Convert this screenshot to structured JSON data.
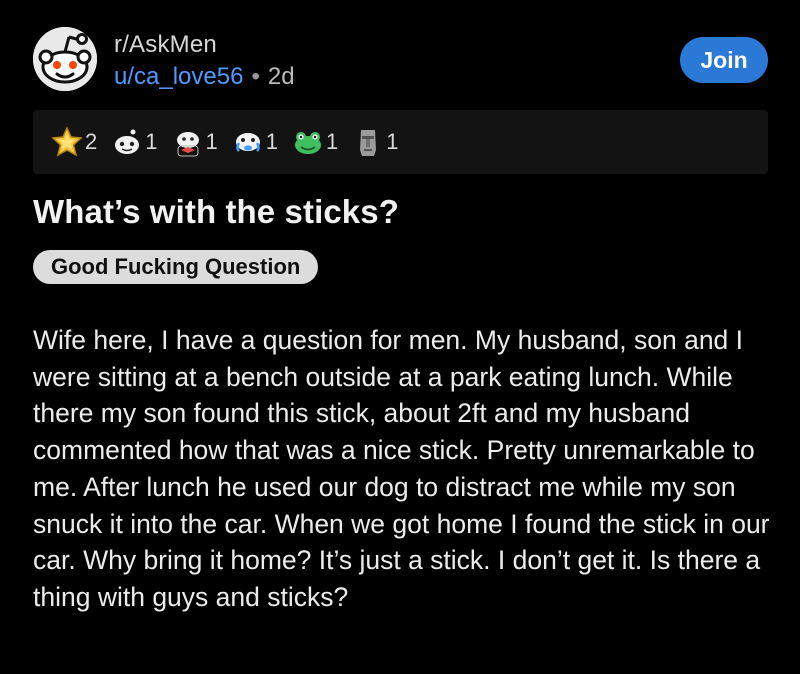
{
  "post": {
    "subreddit": "r/AskMen",
    "username": "u/ca_love56",
    "separator": "•",
    "age": "2d",
    "join_label": "Join",
    "title": "What’s with the sticks?",
    "flair": "Good Fucking Question",
    "body": "Wife here, I have a question for men. My husband, son and I were sitting at a bench outside at a park eating lunch. While there my son found this stick, about 2ft and my husband commented how that was a nice stick. Pretty unremarkable to me. After lunch he used our dog to distract me while my son snuck it into the car. When we got home I found the stick in our car. Why bring it home? It’s just a stick. I don’t get it. Is there a thing with guys and sticks?"
  },
  "awards": [
    {
      "icon": "gold-star-award-icon",
      "count": "2"
    },
    {
      "icon": "snoo-face-award-icon",
      "count": "1"
    },
    {
      "icon": "snoo-bowtie-award-icon",
      "count": "1"
    },
    {
      "icon": "snoo-tears-award-icon",
      "count": "1"
    },
    {
      "icon": "green-frog-award-icon",
      "count": "1"
    },
    {
      "icon": "moai-award-icon",
      "count": "1"
    }
  ],
  "colors": {
    "background": "#000000",
    "username": "#4e9bff",
    "join_button": "#2b79d6",
    "flair_bg": "#dcdcdc",
    "award_bar": "#131313"
  }
}
